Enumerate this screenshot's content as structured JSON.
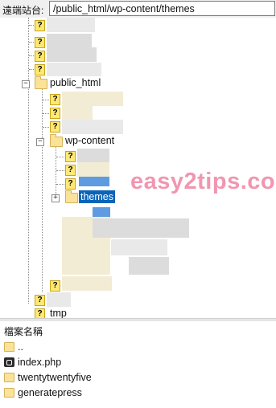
{
  "remote_site": {
    "label": "遠端站台:",
    "path": "/public_html/wp-content/themes"
  },
  "tree": {
    "public_html": "public_html",
    "wp_content": "wp-content",
    "themes": "themes",
    "tmp_partial": "tmp",
    "unknown_icon": "?",
    "expand_glyph": "+",
    "collapse_glyph": "−"
  },
  "watermark": "easy2tips.com",
  "file_list": {
    "column_header": "檔案名稱",
    "items": [
      {
        "name": "..",
        "icon": "folder-icon"
      },
      {
        "name": "index.php",
        "icon": "php-file-icon"
      },
      {
        "name": "twentytwentyfive",
        "icon": "folder-icon"
      },
      {
        "name": "generatepress",
        "icon": "folder-icon"
      }
    ]
  }
}
